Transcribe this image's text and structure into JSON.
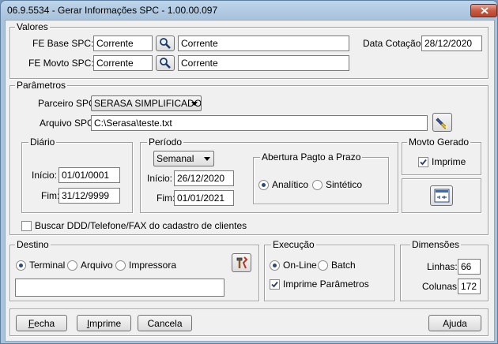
{
  "window": {
    "title": "06.9.5534 - Gerar Informações SPC - 1.00.00.097"
  },
  "valores": {
    "legend": "Valores",
    "fe_base_label": "FE Base SPC:",
    "fe_base_code": "Corrente",
    "fe_base_desc": "Corrente",
    "fe_movto_label": "FE Movto SPC:",
    "fe_movto_code": "Corrente",
    "fe_movto_desc": "Corrente",
    "data_cotacao_label": "Data Cotação:",
    "data_cotacao_value": "28/12/2020"
  },
  "parametros": {
    "legend": "Parâmetros",
    "parceiro_label": "Parceiro SPC:",
    "parceiro_value": "SERASA SIMPLIFICADO",
    "arquivo_label": "Arquivo SPC:",
    "arquivo_value": "C:\\Serasa\\teste.txt",
    "buscar_ddd_label": "Buscar DDD/Telefone/FAX do cadastro de clientes",
    "buscar_ddd_checked": false
  },
  "diario": {
    "legend": "Diário",
    "inicio_label": "Início:",
    "inicio_value": "01/01/0001",
    "fim_label": "Fim:",
    "fim_value": "31/12/9999"
  },
  "periodo": {
    "legend": "Período",
    "tipo_value": "Semanal",
    "inicio_label": "Início:",
    "inicio_value": "26/12/2020",
    "fim_label": "Fim:",
    "fim_value": "01/01/2021"
  },
  "abertura": {
    "legend": "Abertura Pagto a Prazo",
    "analitico_label": "Analítico",
    "sintetico_label": "Sintético",
    "selected": "Analítico"
  },
  "movto_gerado": {
    "legend": "Movto Gerado",
    "imprime_label": "Imprime",
    "imprime_checked": true
  },
  "destino": {
    "legend": "Destino",
    "terminal_label": "Terminal",
    "arquivo_label": "Arquivo",
    "impressora_label": "Impressora",
    "selected": "Terminal",
    "path_value": ""
  },
  "execucao": {
    "legend": "Execução",
    "online_label": "On-Line",
    "batch_label": "Batch",
    "selected": "On-Line",
    "imprime_param_label": "Imprime Parâmetros",
    "imprime_param_checked": true
  },
  "dimensoes": {
    "legend": "Dimensões",
    "linhas_label": "Linhas:",
    "linhas_value": "66",
    "colunas_label": "Colunas:",
    "colunas_value": "172"
  },
  "footer": {
    "fecha_u": "F",
    "fecha_rest": "echa",
    "imprime_u": "I",
    "imprime_rest": "mprime",
    "cancela_label": "Cancela",
    "ajuda_label": "Ajuda"
  },
  "icons": {
    "zoom": "magnifier-icon",
    "file": "flashlight-icon",
    "config": "config-icon",
    "tools": "hammer-icon",
    "close": "close-icon"
  }
}
